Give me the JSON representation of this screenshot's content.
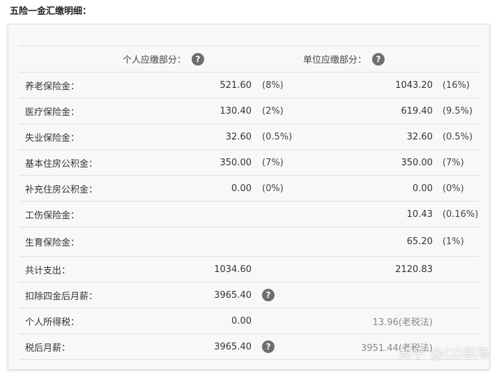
{
  "title": "五险一金汇缴明细：",
  "header": {
    "personal_label": "个人应缴部分：",
    "company_label": "单位应缴部分：",
    "help_glyph": "?"
  },
  "rows": [
    {
      "label": "养老保险金：",
      "personal": "521.60",
      "personal_pct": "(8%)",
      "company": "1043.20",
      "company_pct": "(16%)"
    },
    {
      "label": "医疗保险金：",
      "personal": "130.40",
      "personal_pct": "(2%)",
      "company": "619.40",
      "company_pct": "(9.5%)"
    },
    {
      "label": "失业保险金：",
      "personal": "32.60",
      "personal_pct": "(0.5%)",
      "company": "32.60",
      "company_pct": "(0.5%)"
    },
    {
      "label": "基本住房公积金：",
      "personal": "350.00",
      "personal_pct": "(7%)",
      "company": "350.00",
      "company_pct": "(7%)"
    },
    {
      "label": "补充住房公积金：",
      "personal": "0.00",
      "personal_pct": "(0%)",
      "company": "0.00",
      "company_pct": "(0%)"
    },
    {
      "label": "工伤保险金：",
      "personal": "",
      "personal_pct": "",
      "company": "10.43",
      "company_pct": "(0.16%)"
    },
    {
      "label": "生育保险金：",
      "personal": "",
      "personal_pct": "",
      "company": "65.20",
      "company_pct": "(1%)"
    }
  ],
  "summary": {
    "total_label": "共计支出：",
    "total_personal": "1034.60",
    "total_company": "2120.83",
    "after_deduct_label": "扣除四金后月薪：",
    "after_deduct_value": "3965.40",
    "tax_label": "个人所得税：",
    "tax_value": "0.00",
    "tax_old": "13.96(老税法)",
    "net_label": "税后月薪：",
    "net_value": "3965.40",
    "net_old": "3951.44(老税法)"
  },
  "watermark": "知乎 @CD职场",
  "colors": {
    "help_icon": "#6e6e6e",
    "muted_text": "#888888",
    "card_bg": "#f7f8f8"
  }
}
